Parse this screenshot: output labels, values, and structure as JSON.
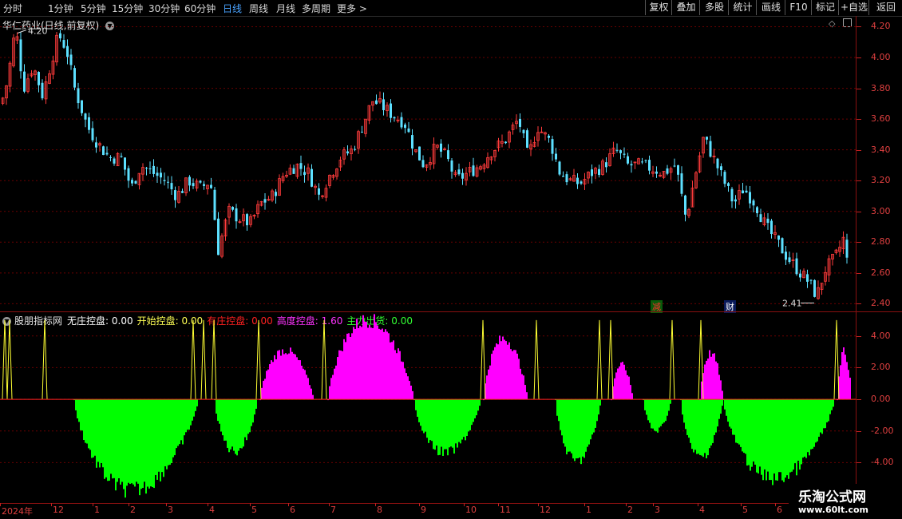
{
  "topbar": {
    "periods": [
      "分时",
      "1分钟",
      "5分钟",
      "15分钟",
      "30分钟",
      "60分钟",
      "日线",
      "周线",
      "月线",
      "多周期",
      "更多 >"
    ],
    "active": "日线",
    "buttons": [
      "复权",
      "叠加",
      "多股",
      "统计",
      "画线",
      "F10",
      "标记",
      "+自选",
      "返回"
    ]
  },
  "chart": {
    "name": "华仁药业(日线,前复权)",
    "high_label": "4.20",
    "low_label": "2.41",
    "marker1": "减",
    "marker2": "财",
    "up_color": "#ff3b3b",
    "down_color": "#5de0ff"
  },
  "indicator": {
    "name": "股朋指标网",
    "items": [
      {
        "label": "无庄控盘:",
        "value": "0.00",
        "color": "#ffffff"
      },
      {
        "label": "开始控盘:",
        "value": "0.00",
        "color": "#ffff55"
      },
      {
        "label": "有庄控盘:",
        "value": "0.00",
        "color": "#ff2020"
      },
      {
        "label": "高度控盘:",
        "value": "1.60",
        "color": "#ff33ff"
      },
      {
        "label": "主力出货:",
        "value": "0.00",
        "color": "#33ff33"
      }
    ],
    "pos_color": "#ff00ff",
    "neg_color": "#00ff00"
  },
  "price_axis": [
    "4.20",
    "4.00",
    "3.80",
    "3.60",
    "3.40",
    "3.20",
    "3.00",
    "2.80",
    "2.60",
    "2.40"
  ],
  "ind_axis": [
    "4.00",
    "2.00",
    "0.00",
    "-2.00",
    "-4.00"
  ],
  "time_axis": [
    "2024年",
    "12",
    "1",
    "2",
    "3",
    "4",
    "5",
    "6",
    "7",
    "8",
    "9",
    "10",
    "11",
    "12",
    "1",
    "2",
    "3",
    "4",
    "5",
    "6"
  ],
  "watermark": {
    "title": "乐淘公式网",
    "url": "www.60lt.com"
  },
  "chart_data": {
    "type": "candlestick",
    "price_range": [
      2.35,
      4.27
    ],
    "indicator_range": [
      -6.5,
      5.5
    ],
    "anchors": [
      [
        0,
        3.7
      ],
      [
        8,
        3.85
      ],
      [
        18,
        4.2
      ],
      [
        28,
        3.8
      ],
      [
        40,
        3.95
      ],
      [
        52,
        3.75
      ],
      [
        64,
        4.0
      ],
      [
        72,
        4.15
      ],
      [
        82,
        4.05
      ],
      [
        92,
        3.8
      ],
      [
        108,
        3.55
      ],
      [
        120,
        3.45
      ],
      [
        135,
        3.35
      ],
      [
        150,
        3.35
      ],
      [
        163,
        3.15
      ],
      [
        175,
        3.3
      ],
      [
        190,
        3.25
      ],
      [
        205,
        3.2
      ],
      [
        220,
        3.1
      ],
      [
        235,
        3.2
      ],
      [
        250,
        3.15
      ],
      [
        262,
        3.2
      ],
      [
        272,
        2.75
      ],
      [
        285,
        3.0
      ],
      [
        300,
        2.95
      ],
      [
        312,
        2.92
      ],
      [
        325,
        3.05
      ],
      [
        340,
        3.1
      ],
      [
        355,
        3.25
      ],
      [
        370,
        3.3
      ],
      [
        385,
        3.25
      ],
      [
        398,
        3.1
      ],
      [
        410,
        3.22
      ],
      [
        425,
        3.35
      ],
      [
        440,
        3.4
      ],
      [
        452,
        3.55
      ],
      [
        465,
        3.72
      ],
      [
        478,
        3.68
      ],
      [
        492,
        3.62
      ],
      [
        505,
        3.58
      ],
      [
        518,
        3.4
      ],
      [
        530,
        3.3
      ],
      [
        545,
        3.42
      ],
      [
        558,
        3.35
      ],
      [
        570,
        3.2
      ],
      [
        585,
        3.25
      ],
      [
        600,
        3.3
      ],
      [
        615,
        3.4
      ],
      [
        630,
        3.45
      ],
      [
        648,
        3.6
      ],
      [
        660,
        3.35
      ],
      [
        672,
        3.55
      ],
      [
        688,
        3.45
      ],
      [
        700,
        3.25
      ],
      [
        712,
        3.2
      ],
      [
        725,
        3.18
      ],
      [
        740,
        3.25
      ],
      [
        755,
        3.3
      ],
      [
        770,
        3.4
      ],
      [
        785,
        3.3
      ],
      [
        800,
        3.3
      ],
      [
        815,
        3.28
      ],
      [
        830,
        3.25
      ],
      [
        845,
        3.3
      ],
      [
        858,
        2.95
      ],
      [
        868,
        3.2
      ],
      [
        880,
        3.48
      ],
      [
        892,
        3.35
      ],
      [
        905,
        3.2
      ],
      [
        918,
        3.05
      ],
      [
        930,
        3.15
      ],
      [
        945,
        3.05
      ],
      [
        958,
        2.9
      ],
      [
        972,
        2.8
      ],
      [
        985,
        2.7
      ],
      [
        998,
        2.62
      ],
      [
        1010,
        2.55
      ],
      [
        1022,
        2.45
      ],
      [
        1032,
        2.62
      ],
      [
        1045,
        2.7
      ],
      [
        1055,
        2.82
      ],
      [
        1062,
        2.6
      ]
    ],
    "indicator_segments": [
      {
        "x": [
          92,
          248
        ],
        "peak": -6.3,
        "sign": "neg"
      },
      {
        "x": [
          268,
          322
        ],
        "peak": -3.6,
        "sign": "neg"
      },
      {
        "x": [
          325,
          392
        ],
        "peak": 3.4,
        "sign": "pos"
      },
      {
        "x": [
          410,
          518
        ],
        "peak": 5.5,
        "sign": "pos"
      },
      {
        "x": [
          518,
          602
        ],
        "peak": -3.7,
        "sign": "neg"
      },
      {
        "x": [
          605,
          660
        ],
        "peak": 4.2,
        "sign": "pos"
      },
      {
        "x": [
          695,
          752
        ],
        "peak": -4.3,
        "sign": "neg"
      },
      {
        "x": [
          765,
          792
        ],
        "peak": 2.4,
        "sign": "pos"
      },
      {
        "x": [
          805,
          840
        ],
        "peak": -2.2,
        "sign": "neg"
      },
      {
        "x": [
          852,
          905
        ],
        "peak": -4.0,
        "sign": "neg"
      },
      {
        "x": [
          876,
          905
        ],
        "peak": 3.2,
        "sign": "pos"
      },
      {
        "x": [
          905,
          1045
        ],
        "peak": -5.5,
        "sign": "neg"
      },
      {
        "x": [
          1048,
          1066
        ],
        "peak": 3.3,
        "sign": "pos"
      }
    ]
  }
}
